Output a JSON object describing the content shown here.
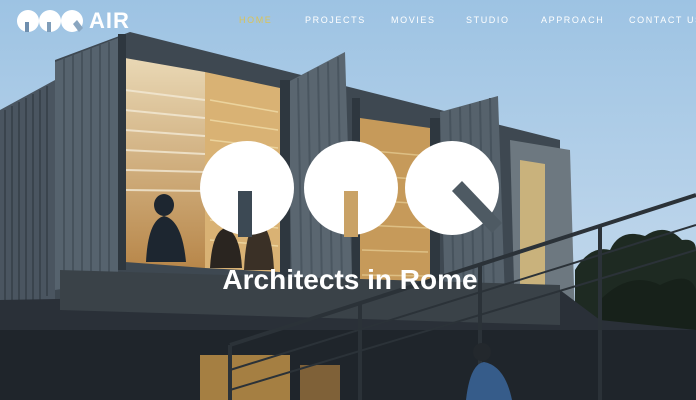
{
  "brand": {
    "mark_icon": "aoq-logo-icon",
    "name": "AIR"
  },
  "nav": {
    "items": [
      {
        "label": "HOME",
        "active": true
      },
      {
        "label": "PROJECTS",
        "active": false
      },
      {
        "label": "MOVIES",
        "active": false
      },
      {
        "label": "STUDIO",
        "active": false
      },
      {
        "label": "APPROACH",
        "active": false
      },
      {
        "label": "CONTACT US",
        "active": false
      }
    ],
    "active_color": "#d9c35a",
    "text_color": "#ffffff"
  },
  "hero": {
    "logo_icon": "aoq-hero-logo-icon",
    "title": "Architects in Rome",
    "background": "photo-shipping-container-building-at-dusk"
  }
}
